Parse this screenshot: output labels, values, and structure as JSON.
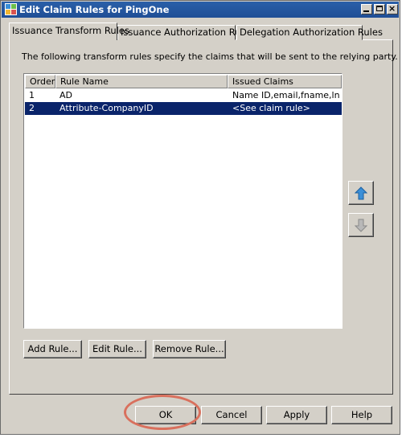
{
  "window": {
    "title": "Edit Claim Rules for PingOne"
  },
  "tabs": [
    {
      "label": "Issuance Transform Rules",
      "active": true
    },
    {
      "label": "Issuance Authorization Rules",
      "active": false
    },
    {
      "label": "Delegation Authorization Rules",
      "active": false
    }
  ],
  "description": "The following transform rules specify the claims that will be sent to the relying party.",
  "rules_table": {
    "columns": [
      "Order",
      "Rule Name",
      "Issued Claims"
    ],
    "rows": [
      {
        "order": "1",
        "name": "AD",
        "claims": "Name ID,email,fname,lna...",
        "selected": false
      },
      {
        "order": "2",
        "name": "Attribute-CompanyID",
        "claims": "<See claim rule>",
        "selected": true
      }
    ]
  },
  "rule_buttons": {
    "add": "Add Rule...",
    "edit": "Edit Rule...",
    "remove": "Remove Rule..."
  },
  "footer_buttons": {
    "ok": "OK",
    "cancel": "Cancel",
    "apply": "Apply",
    "help": "Help"
  },
  "icons": {
    "app": "window-app-icon",
    "move_up": "arrow-up-icon",
    "move_down": "arrow-down-icon"
  },
  "colors": {
    "title_bar": "#1f4e96",
    "selection": "#0a246a",
    "up_arrow": "#3a8fd8",
    "disabled_arrow": "#a0a0a0",
    "highlight_ring": "#d9705d"
  }
}
